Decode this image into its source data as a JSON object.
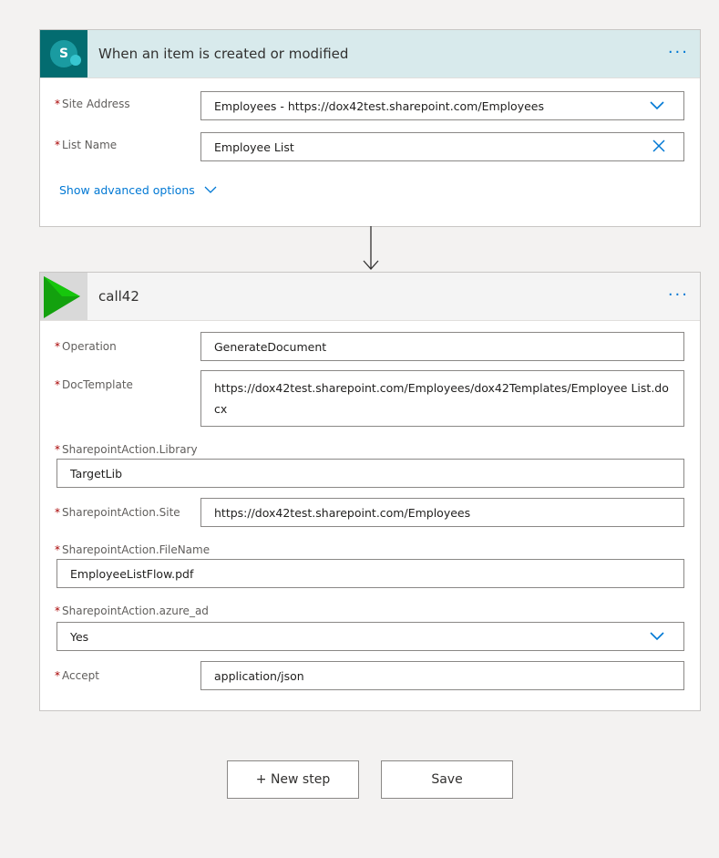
{
  "trigger": {
    "title": "When an item is created or modified",
    "more_label": "···",
    "site_address": {
      "label": "Site Address",
      "value": "Employees - https://dox42test.sharepoint.com/Employees"
    },
    "list_name": {
      "label": "List Name",
      "value": "Employee List"
    },
    "advanced_label": "Show advanced options"
  },
  "action": {
    "title": "call42",
    "more_label": "···",
    "fields": {
      "operation": {
        "label": "Operation",
        "value": "GenerateDocument"
      },
      "doc_template": {
        "label": "DocTemplate",
        "value": "https://dox42test.sharepoint.com/Employees/dox42Templates/Employee List.docx"
      },
      "library": {
        "label": "SharepointAction.Library",
        "value": "TargetLib"
      },
      "site": {
        "label": "SharepointAction.Site",
        "value": "https://dox42test.sharepoint.com/Employees"
      },
      "file_name": {
        "label": "SharepointAction.FileName",
        "value": "EmployeeListFlow.pdf"
      },
      "azure_ad": {
        "label": "SharepointAction.azure_ad",
        "value": "Yes"
      },
      "accept": {
        "label": "Accept",
        "value": "application/json"
      }
    }
  },
  "required_marker": "*",
  "buttons": {
    "new_step": "+ New step",
    "save": "Save"
  },
  "colors": {
    "accent": "#0078d4",
    "trigger_header": "#d8eaec",
    "sharepoint_teal": "#036c70",
    "action_icon_green": "#13a10e",
    "required": "#a80000"
  },
  "icons": {
    "trigger": "sharepoint-icon",
    "action": "play-icon",
    "dropdown": "chevron-down-icon",
    "clear": "close-icon",
    "connector": "arrow-down-icon"
  }
}
